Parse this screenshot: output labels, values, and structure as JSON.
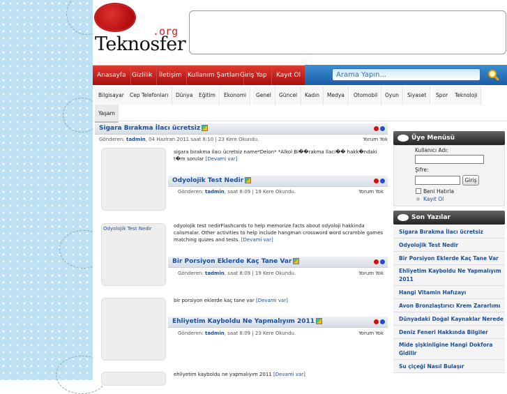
{
  "site": {
    "logo_org": ".org",
    "logo_name": "Teknosfer"
  },
  "nav": {
    "items": [
      "Anasayfa",
      "Gizlilik",
      "İletişim",
      "Kullanım Şartları",
      "Giriş Yap",
      "Kayıt Ol"
    ],
    "search_placeholder": "Arama Yapın..."
  },
  "categories": {
    "row1": [
      "Bilgisayar",
      "Cep Telefonları",
      "Dünya",
      "Eğitim",
      "Ekonomi",
      "Genel",
      "Güncel",
      "Kadın",
      "Medya",
      "Otomobil",
      "Oyun",
      "Siyaset",
      "Spor",
      "Teknoloji"
    ],
    "row2": [
      "Yaşam"
    ]
  },
  "posts": [
    {
      "title": "Sigara Bırakma İlacı ücretsiz",
      "meta_prefix": "Gönderen:",
      "author": "tadmin",
      "meta_suffix": ", 04 Haziran 2011 saat 8:10 | 23 Kere Okundu.",
      "comments": "Yorum Yok",
      "excerpt": "sigara bırakma ilacı ücretsiz name*Deion* *Alkol Bi��rakma İlaci�� hakk�ndaki t�m sorular",
      "more": "[Devami var]"
    },
    {
      "title": "Odyolojik Test Nedir",
      "meta_prefix": "Gönderen:",
      "author": "tadmin",
      "meta_suffix": ", saat 8:09 | 19 Kere Okundu.",
      "comments": "Yorum Yok",
      "thumb_caption": "Odyolojik Test Nedir",
      "excerpt": "odyolojik test nedirFlashcards to help memorize facts about odyoloji hakkinda calismalar. Other activities to help include hangman crossword word scramble games matching quizes and tests.",
      "more": "[Devami var]"
    },
    {
      "title": "Bir Porsiyon Eklerde Kaç Tane Var",
      "meta_prefix": "Gönderen:",
      "author": "tadmin",
      "meta_suffix": ", saat 8:09 | 19 Kere Okundu.",
      "comments": "Yorum Yok",
      "excerpt": "bir porsiyon eklerde kaç tane var",
      "more": "[Devami var]"
    },
    {
      "title": "Ehliyetim Kayboldu Ne Yapmalıyım 2011",
      "meta_prefix": "Gönderen:",
      "author": "tadmin",
      "meta_suffix": ", saat 8:09 | 23 Kere Okundu.",
      "comments": "Yorum Yok",
      "excerpt": "ehliyetim kayboldu ne yapmalıyım 2011",
      "more": "[Devami var]"
    }
  ],
  "sidebar": {
    "member_title": "Üye Menüsü",
    "username_label": "Kullanıcı Adı:",
    "password_label": "Şifre:",
    "login_button": "Giriş",
    "remember_label": "Beni Hatırla",
    "register_link": "Kayıt Ol",
    "recent_title": "Son Yazılar",
    "recent": [
      "Sigara Bırakma İlacı ücretsiz",
      "Odyolojik Test Nedir",
      "Bir Porsiyon Eklerde Kaç Tane Var",
      "Ehliyetim Kayboldu Ne Yapmalıyım 2011",
      "Hangi Vitamin Hafızayı",
      "Avon Bronzlaştırıcı Krem Zararlımı",
      "Dünyadaki Doğal Kaynaklar Nerede",
      "Deniz Feneri Hakkında Bilgiler",
      "Mide şişkinligine Hangi Dokfora Gidilir",
      "Su çiçeği Nasıl Bulaşır"
    ]
  },
  "colors": {
    "nav_red": "#c41e1e",
    "search_blue": "#2a6fb7",
    "link_blue": "#1a4f9c",
    "dot_red": "#d21010",
    "dot_blue": "#1f4fd0"
  }
}
